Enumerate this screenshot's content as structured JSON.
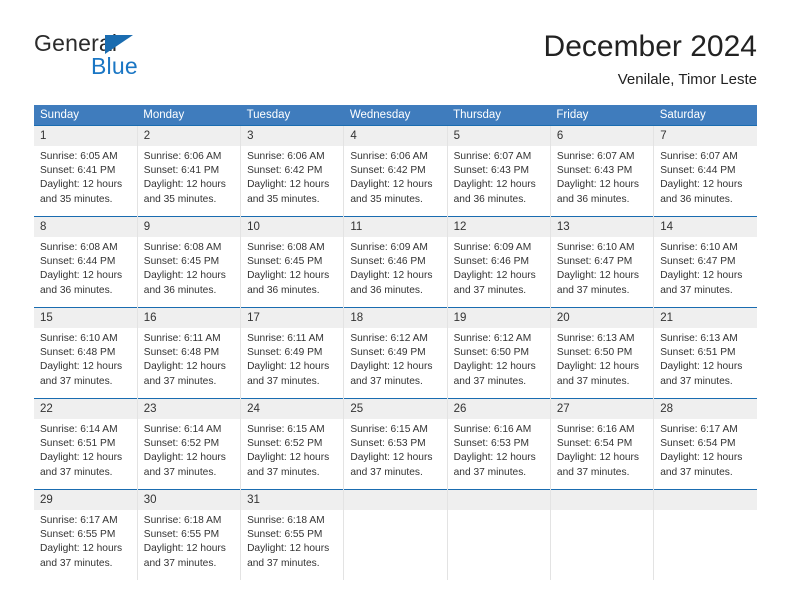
{
  "brand": {
    "name_top": "General",
    "name_bottom": "Blue",
    "triangle_color": "#1a6cb0",
    "blue_text_color": "#1a76c4"
  },
  "header": {
    "title": "December 2024",
    "subtitle": "Venilale, Timor Leste"
  },
  "theme": {
    "header_blue": "#3f7cbd",
    "row_rule_blue": "#1a6cb0",
    "daynum_band": "#efefef",
    "cell_divider": "#e3e3e3",
    "text": "#333333"
  },
  "weekdays": [
    "Sunday",
    "Monday",
    "Tuesday",
    "Wednesday",
    "Thursday",
    "Friday",
    "Saturday"
  ],
  "weeks": [
    [
      {
        "day": "1",
        "sunrise": "Sunrise: 6:05 AM",
        "sunset": "Sunset: 6:41 PM",
        "daylight1": "Daylight: 12 hours",
        "daylight2": "and 35 minutes."
      },
      {
        "day": "2",
        "sunrise": "Sunrise: 6:06 AM",
        "sunset": "Sunset: 6:41 PM",
        "daylight1": "Daylight: 12 hours",
        "daylight2": "and 35 minutes."
      },
      {
        "day": "3",
        "sunrise": "Sunrise: 6:06 AM",
        "sunset": "Sunset: 6:42 PM",
        "daylight1": "Daylight: 12 hours",
        "daylight2": "and 35 minutes."
      },
      {
        "day": "4",
        "sunrise": "Sunrise: 6:06 AM",
        "sunset": "Sunset: 6:42 PM",
        "daylight1": "Daylight: 12 hours",
        "daylight2": "and 35 minutes."
      },
      {
        "day": "5",
        "sunrise": "Sunrise: 6:07 AM",
        "sunset": "Sunset: 6:43 PM",
        "daylight1": "Daylight: 12 hours",
        "daylight2": "and 36 minutes."
      },
      {
        "day": "6",
        "sunrise": "Sunrise: 6:07 AM",
        "sunset": "Sunset: 6:43 PM",
        "daylight1": "Daylight: 12 hours",
        "daylight2": "and 36 minutes."
      },
      {
        "day": "7",
        "sunrise": "Sunrise: 6:07 AM",
        "sunset": "Sunset: 6:44 PM",
        "daylight1": "Daylight: 12 hours",
        "daylight2": "and 36 minutes."
      }
    ],
    [
      {
        "day": "8",
        "sunrise": "Sunrise: 6:08 AM",
        "sunset": "Sunset: 6:44 PM",
        "daylight1": "Daylight: 12 hours",
        "daylight2": "and 36 minutes."
      },
      {
        "day": "9",
        "sunrise": "Sunrise: 6:08 AM",
        "sunset": "Sunset: 6:45 PM",
        "daylight1": "Daylight: 12 hours",
        "daylight2": "and 36 minutes."
      },
      {
        "day": "10",
        "sunrise": "Sunrise: 6:08 AM",
        "sunset": "Sunset: 6:45 PM",
        "daylight1": "Daylight: 12 hours",
        "daylight2": "and 36 minutes."
      },
      {
        "day": "11",
        "sunrise": "Sunrise: 6:09 AM",
        "sunset": "Sunset: 6:46 PM",
        "daylight1": "Daylight: 12 hours",
        "daylight2": "and 36 minutes."
      },
      {
        "day": "12",
        "sunrise": "Sunrise: 6:09 AM",
        "sunset": "Sunset: 6:46 PM",
        "daylight1": "Daylight: 12 hours",
        "daylight2": "and 37 minutes."
      },
      {
        "day": "13",
        "sunrise": "Sunrise: 6:10 AM",
        "sunset": "Sunset: 6:47 PM",
        "daylight1": "Daylight: 12 hours",
        "daylight2": "and 37 minutes."
      },
      {
        "day": "14",
        "sunrise": "Sunrise: 6:10 AM",
        "sunset": "Sunset: 6:47 PM",
        "daylight1": "Daylight: 12 hours",
        "daylight2": "and 37 minutes."
      }
    ],
    [
      {
        "day": "15",
        "sunrise": "Sunrise: 6:10 AM",
        "sunset": "Sunset: 6:48 PM",
        "daylight1": "Daylight: 12 hours",
        "daylight2": "and 37 minutes."
      },
      {
        "day": "16",
        "sunrise": "Sunrise: 6:11 AM",
        "sunset": "Sunset: 6:48 PM",
        "daylight1": "Daylight: 12 hours",
        "daylight2": "and 37 minutes."
      },
      {
        "day": "17",
        "sunrise": "Sunrise: 6:11 AM",
        "sunset": "Sunset: 6:49 PM",
        "daylight1": "Daylight: 12 hours",
        "daylight2": "and 37 minutes."
      },
      {
        "day": "18",
        "sunrise": "Sunrise: 6:12 AM",
        "sunset": "Sunset: 6:49 PM",
        "daylight1": "Daylight: 12 hours",
        "daylight2": "and 37 minutes."
      },
      {
        "day": "19",
        "sunrise": "Sunrise: 6:12 AM",
        "sunset": "Sunset: 6:50 PM",
        "daylight1": "Daylight: 12 hours",
        "daylight2": "and 37 minutes."
      },
      {
        "day": "20",
        "sunrise": "Sunrise: 6:13 AM",
        "sunset": "Sunset: 6:50 PM",
        "daylight1": "Daylight: 12 hours",
        "daylight2": "and 37 minutes."
      },
      {
        "day": "21",
        "sunrise": "Sunrise: 6:13 AM",
        "sunset": "Sunset: 6:51 PM",
        "daylight1": "Daylight: 12 hours",
        "daylight2": "and 37 minutes."
      }
    ],
    [
      {
        "day": "22",
        "sunrise": "Sunrise: 6:14 AM",
        "sunset": "Sunset: 6:51 PM",
        "daylight1": "Daylight: 12 hours",
        "daylight2": "and 37 minutes."
      },
      {
        "day": "23",
        "sunrise": "Sunrise: 6:14 AM",
        "sunset": "Sunset: 6:52 PM",
        "daylight1": "Daylight: 12 hours",
        "daylight2": "and 37 minutes."
      },
      {
        "day": "24",
        "sunrise": "Sunrise: 6:15 AM",
        "sunset": "Sunset: 6:52 PM",
        "daylight1": "Daylight: 12 hours",
        "daylight2": "and 37 minutes."
      },
      {
        "day": "25",
        "sunrise": "Sunrise: 6:15 AM",
        "sunset": "Sunset: 6:53 PM",
        "daylight1": "Daylight: 12 hours",
        "daylight2": "and 37 minutes."
      },
      {
        "day": "26",
        "sunrise": "Sunrise: 6:16 AM",
        "sunset": "Sunset: 6:53 PM",
        "daylight1": "Daylight: 12 hours",
        "daylight2": "and 37 minutes."
      },
      {
        "day": "27",
        "sunrise": "Sunrise: 6:16 AM",
        "sunset": "Sunset: 6:54 PM",
        "daylight1": "Daylight: 12 hours",
        "daylight2": "and 37 minutes."
      },
      {
        "day": "28",
        "sunrise": "Sunrise: 6:17 AM",
        "sunset": "Sunset: 6:54 PM",
        "daylight1": "Daylight: 12 hours",
        "daylight2": "and 37 minutes."
      }
    ],
    [
      {
        "day": "29",
        "sunrise": "Sunrise: 6:17 AM",
        "sunset": "Sunset: 6:55 PM",
        "daylight1": "Daylight: 12 hours",
        "daylight2": "and 37 minutes."
      },
      {
        "day": "30",
        "sunrise": "Sunrise: 6:18 AM",
        "sunset": "Sunset: 6:55 PM",
        "daylight1": "Daylight: 12 hours",
        "daylight2": "and 37 minutes."
      },
      {
        "day": "31",
        "sunrise": "Sunrise: 6:18 AM",
        "sunset": "Sunset: 6:55 PM",
        "daylight1": "Daylight: 12 hours",
        "daylight2": "and 37 minutes."
      },
      {
        "day": "",
        "sunrise": "",
        "sunset": "",
        "daylight1": "",
        "daylight2": ""
      },
      {
        "day": "",
        "sunrise": "",
        "sunset": "",
        "daylight1": "",
        "daylight2": ""
      },
      {
        "day": "",
        "sunrise": "",
        "sunset": "",
        "daylight1": "",
        "daylight2": ""
      },
      {
        "day": "",
        "sunrise": "",
        "sunset": "",
        "daylight1": "",
        "daylight2": ""
      }
    ]
  ]
}
